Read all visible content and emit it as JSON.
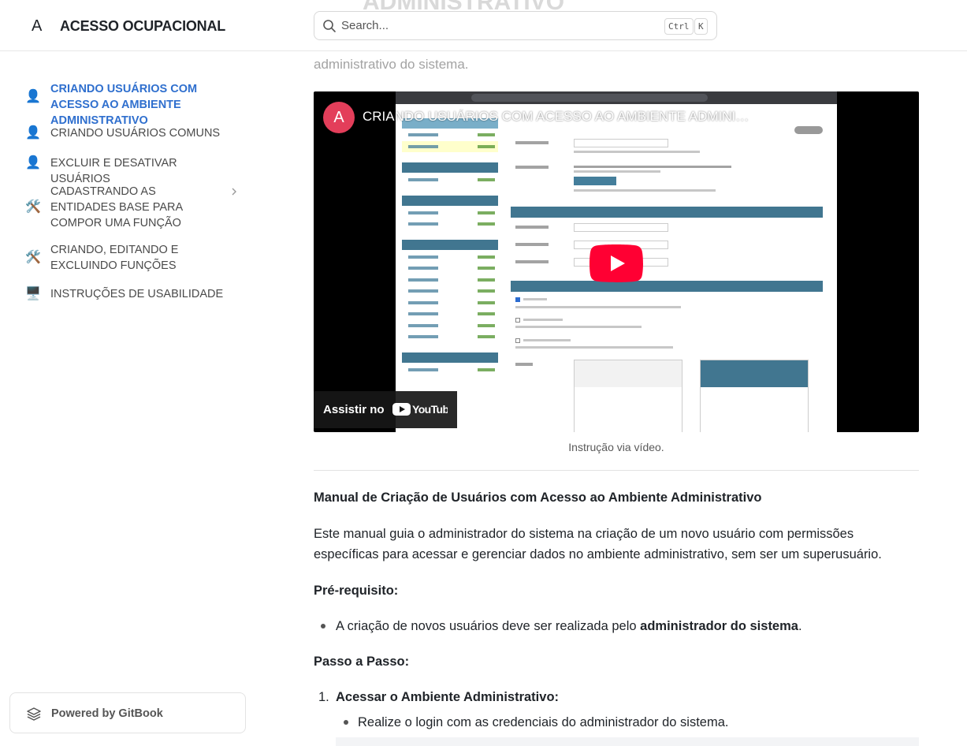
{
  "header": {
    "logo": "A",
    "site_title": "ACESSO OCUPACIONAL",
    "search_placeholder": "Search...",
    "shortcut_ctrl": "Ctrl",
    "shortcut_k": "K"
  },
  "page": {
    "title_partial": "ADMINISTRATIVO",
    "intro": "Nessa seção você encontrará instruções para a criação de usuários que terão acesso ao ambiente administrativo do sistema."
  },
  "sidebar": {
    "items": [
      {
        "label": "CRIANDO USUÁRIOS COM ACESSO AO AMBIENTE ADMINISTRATIVO",
        "icon": "user-icon",
        "glyph": "👤",
        "active": true
      },
      {
        "label": "CRIANDO USUÁRIOS COMUNS",
        "icon": "user-icon",
        "glyph": "👤"
      },
      {
        "label": "EXCLUIR E DESATIVAR USUÁRIOS",
        "icon": "user-icon",
        "glyph": "👤"
      },
      {
        "label": "CADASTRANDO AS ENTIDADES BASE PARA COMPOR UMA FUNÇÃO",
        "icon": "tools-icon",
        "glyph": "🛠️",
        "expandable": true
      },
      {
        "label": "CRIANDO, EDITANDO E EXCLUINDO FUNÇÕES",
        "icon": "tools-icon",
        "glyph": "🛠️"
      },
      {
        "label": "INSTRUÇÕES DE USABILIDADE",
        "icon": "monitor-icon",
        "glyph": "🖥️"
      }
    ],
    "powered_by": "Powered by GitBook"
  },
  "video": {
    "avatar_letter": "A",
    "title": "CRIANDO USUÁRIOS COM ACESSO AO AMBIENTE ADMINISTRATIVO",
    "watch_label": "Assistir no",
    "caption": "Instrução via vídeo."
  },
  "article": {
    "heading": "Manual de Criação de Usuários com Acesso ao Ambiente Administrativo",
    "intro": "Este manual guia o administrador do sistema na criação de um novo usuário com permissões específicas para acessar e gerenciar dados no ambiente administrativo, sem ser um superusuário.",
    "prereq_heading": "Pré-requisito:",
    "prereq_text": "A criação de novos usuários deve ser realizada pelo ",
    "prereq_bold": "administrador do sistema",
    "prereq_end": ".",
    "steps_heading": "Passo a Passo:",
    "step1_num": "1.",
    "step1_title": "Acessar o Ambiente Administrativo:",
    "step1_bullet": "Realize o login com as credenciais do administrador do sistema."
  },
  "colors": {
    "accent": "#2f6fce",
    "youtube_red": "#ff0033",
    "avatar": "#e33e5a"
  }
}
